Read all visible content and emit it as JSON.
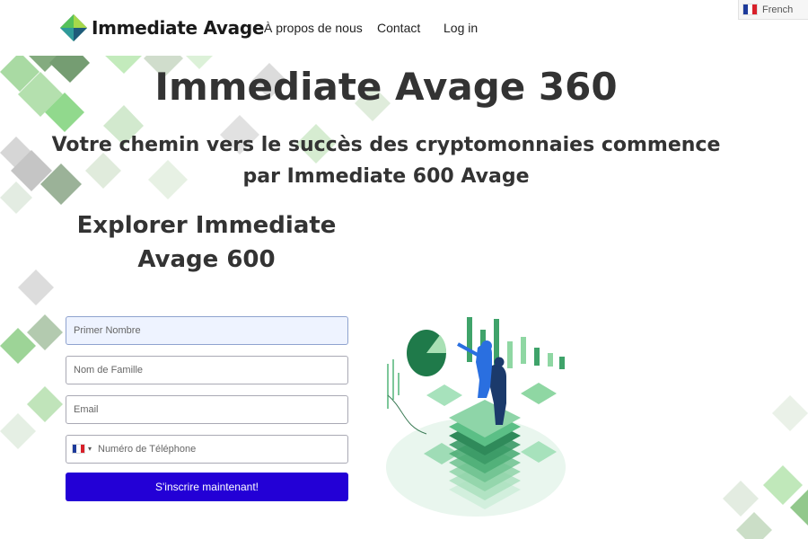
{
  "brand": {
    "name": "Immediate Avage",
    "accent": "#2300d6"
  },
  "nav": {
    "about": "À propos de nous",
    "contact": "Contact",
    "login": "Log in"
  },
  "language": {
    "label": "French",
    "flag": "french-flag-icon"
  },
  "hero": {
    "title": "Immediate Avage 360",
    "subtitle": "Votre chemin vers le succès des cryptomonnaies commence par Immediate 600 Avage"
  },
  "explore": {
    "heading": "Explorer Immediate Avage 600"
  },
  "form": {
    "first_name_placeholder": "Primer Nombre",
    "last_name_placeholder": "Nom de Famille",
    "email_placeholder": "Email",
    "phone_placeholder": "Numéro de Téléphone",
    "phone_flag": "french-flag-icon",
    "submit_label": "S'inscrire maintenant!"
  },
  "colors": {
    "tile_green": "#7ed37a",
    "tile_dark": "#5e8c5a",
    "tile_grey": "#c9c9c9",
    "text": "#333333"
  }
}
